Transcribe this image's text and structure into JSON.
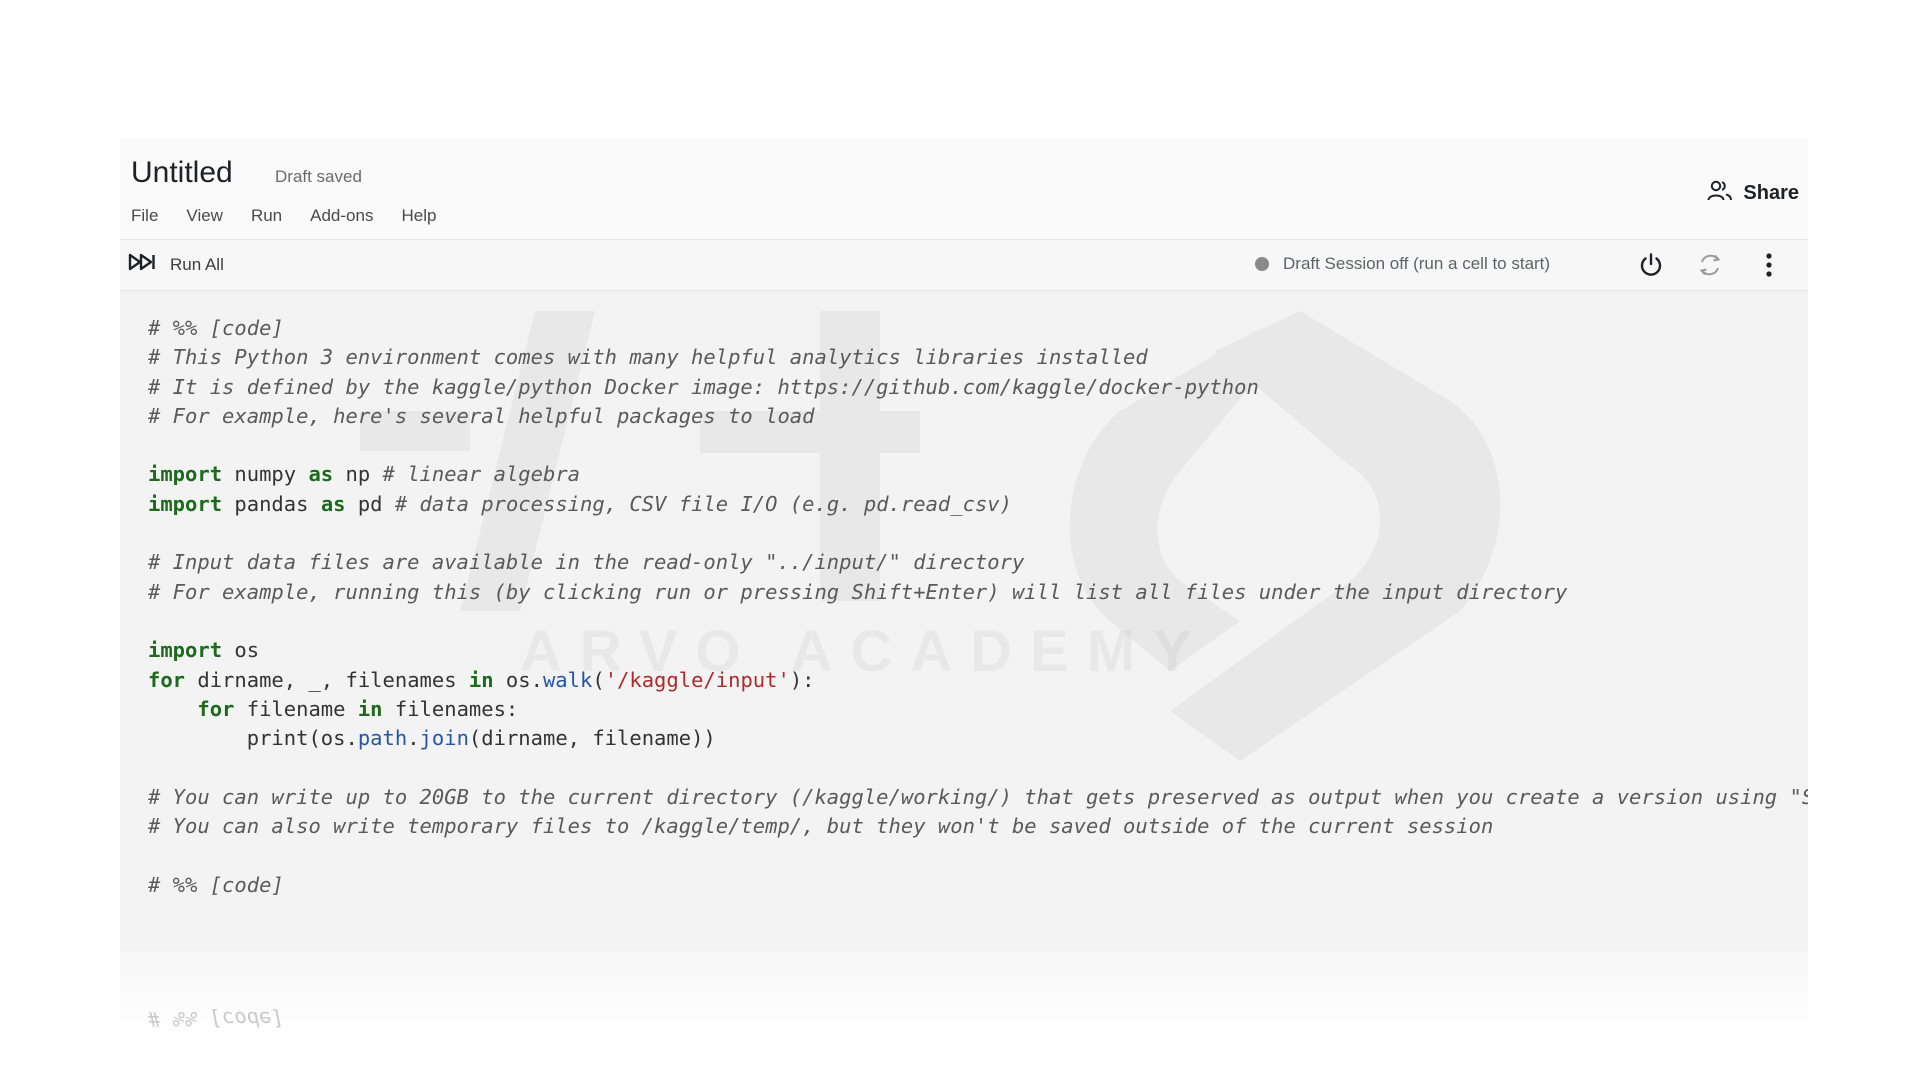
{
  "notebook": {
    "title": "Untitled",
    "draft_status": "Draft saved"
  },
  "menu": {
    "items": [
      {
        "label": "File"
      },
      {
        "label": "View"
      },
      {
        "label": "Run"
      },
      {
        "label": "Add-ons"
      },
      {
        "label": "Help"
      }
    ]
  },
  "header": {
    "share_label": "Share",
    "share_icon": "people-icon"
  },
  "toolbar": {
    "run_all_label": "Run All",
    "run_all_icon": "fast-forward-icon",
    "session_status": "Draft Session off (run a cell to start)",
    "status_dot_color": "#8a8a8a",
    "icons": [
      "power-icon",
      "restart-icon",
      "more-vert-icon"
    ]
  },
  "watermark_text": "ARVO ACADEMY",
  "code": {
    "lines": [
      [
        {
          "t": "# %% [code]",
          "c": "cm"
        }
      ],
      [
        {
          "t": "# This Python 3 environment comes with many helpful analytics libraries installed",
          "c": "cm"
        }
      ],
      [
        {
          "t": "# It is defined by the kaggle/python Docker image: https://github.com/kaggle/docker-python",
          "c": "cm"
        }
      ],
      [
        {
          "t": "# For example, here's several helpful packages to load",
          "c": "cm"
        }
      ],
      [],
      [
        {
          "t": "import",
          "c": "kw"
        },
        {
          "t": " numpy ",
          "c": ""
        },
        {
          "t": "as",
          "c": "kw"
        },
        {
          "t": " np ",
          "c": ""
        },
        {
          "t": "# linear algebra",
          "c": "cm"
        }
      ],
      [
        {
          "t": "import",
          "c": "kw"
        },
        {
          "t": " pandas ",
          "c": ""
        },
        {
          "t": "as",
          "c": "kw"
        },
        {
          "t": " pd ",
          "c": ""
        },
        {
          "t": "# data processing, CSV file I/O (e.g. pd.read_csv)",
          "c": "cm"
        }
      ],
      [],
      [
        {
          "t": "# Input data files are available in the read-only \"../input/\" directory",
          "c": "cm"
        }
      ],
      [
        {
          "t": "# For example, running this (by clicking run or pressing Shift+Enter) will list all files under the input directory",
          "c": "cm"
        }
      ],
      [],
      [
        {
          "t": "import",
          "c": "kw"
        },
        {
          "t": " os",
          "c": ""
        }
      ],
      [
        {
          "t": "for",
          "c": "kw"
        },
        {
          "t": " dirname, _, filenames ",
          "c": ""
        },
        {
          "t": "in",
          "c": "kw"
        },
        {
          "t": " os.",
          "c": ""
        },
        {
          "t": "walk",
          "c": "fn"
        },
        {
          "t": "(",
          "c": ""
        },
        {
          "t": "'/kaggle/input'",
          "c": "st"
        },
        {
          "t": "):",
          "c": ""
        }
      ],
      [
        {
          "t": "    ",
          "c": ""
        },
        {
          "t": "for",
          "c": "kw"
        },
        {
          "t": " filename ",
          "c": ""
        },
        {
          "t": "in",
          "c": "kw"
        },
        {
          "t": " filenames:",
          "c": ""
        }
      ],
      [
        {
          "t": "        print(os.",
          "c": ""
        },
        {
          "t": "path",
          "c": "fn"
        },
        {
          "t": ".",
          "c": ""
        },
        {
          "t": "join",
          "c": "fn"
        },
        {
          "t": "(dirname, filename))",
          "c": ""
        }
      ],
      [],
      [
        {
          "t": "# You can write up to 20GB to the current directory (/kaggle/working/) that gets preserved as output when you create a version using \"S",
          "c": "cm"
        }
      ],
      [
        {
          "t": "# You can also write temporary files to /kaggle/temp/, but they won't be saved outside of the current session",
          "c": "cm"
        }
      ],
      [],
      [
        {
          "t": "# %% [code]",
          "c": "cm"
        }
      ]
    ]
  },
  "reflection_text": "# %% [code]"
}
